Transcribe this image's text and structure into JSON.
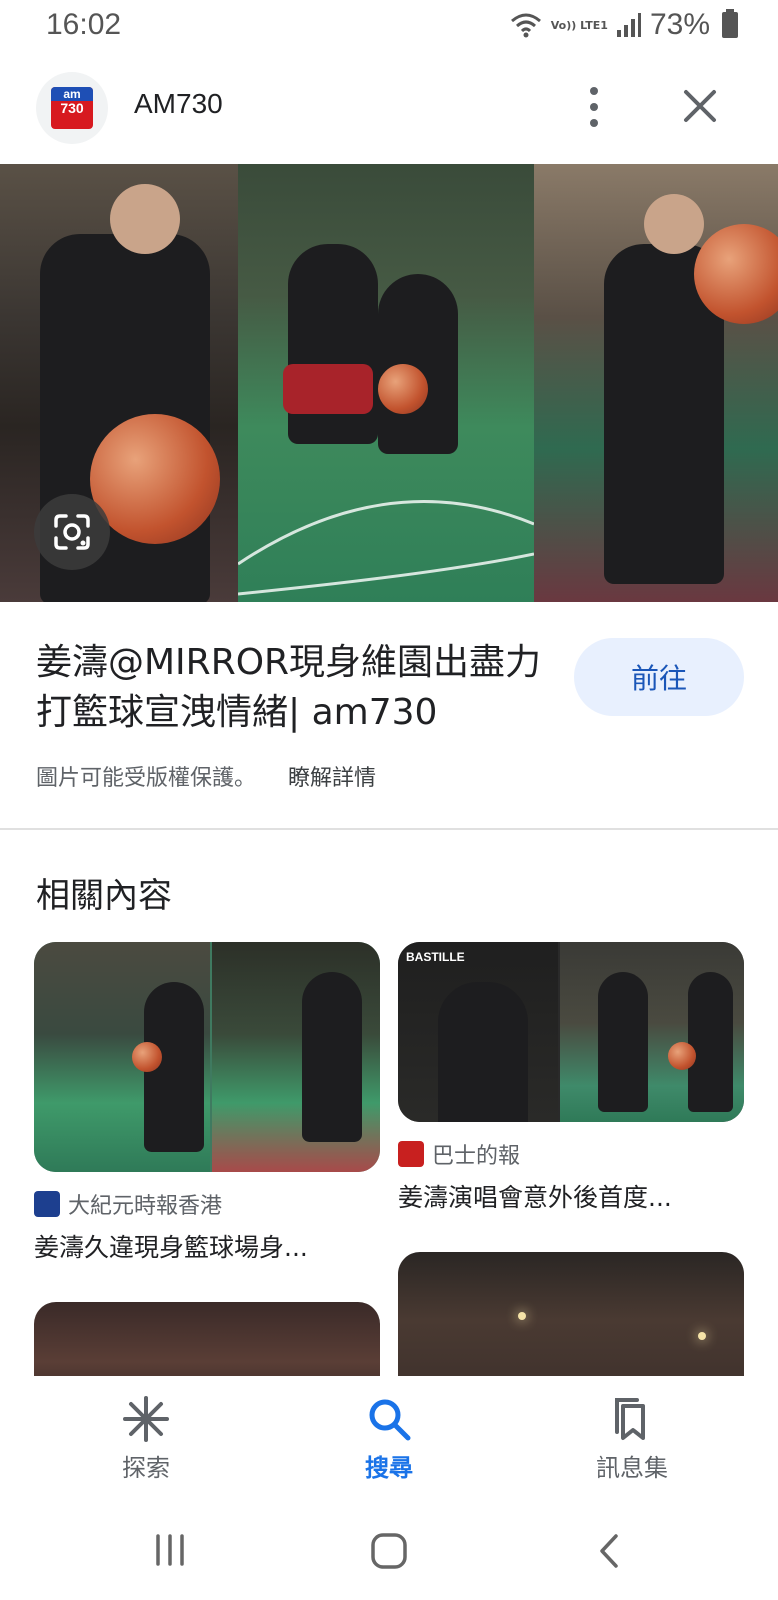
{
  "status_bar": {
    "time": "16:02",
    "battery": "73%",
    "network_label": "Vo)) LTE1"
  },
  "header": {
    "logo_text_top": "am",
    "logo_text_bottom": "730",
    "title": "AM730"
  },
  "result": {
    "title_line1": "姜濤@MIRROR現身維園出盡力",
    "title_line2": "打籃球宣洩情緒| am730",
    "go_label": "前往",
    "copyright_note": "圖片可能受版權保護。",
    "learn_more": "瞭解詳情"
  },
  "related": {
    "heading": "相關內容",
    "cards": [
      {
        "source": "大紀元時報香港",
        "caption": "姜濤久違現身籃球場身..."
      },
      {
        "source": "巴士的報",
        "caption": "姜濤演唱會意外後首度...",
        "image_banner": "BASTILLE"
      }
    ]
  },
  "bottom_nav": {
    "items": [
      {
        "label": "探索",
        "icon": "asterisk-icon"
      },
      {
        "label": "搜尋",
        "icon": "search-icon",
        "active": true
      },
      {
        "label": "訊息集",
        "icon": "collections-icon"
      }
    ]
  },
  "colors": {
    "accent": "#1a73e8",
    "go_button_bg": "#e8f0fe",
    "logo_red": "#d7191f",
    "logo_blue": "#1e4fb5"
  }
}
